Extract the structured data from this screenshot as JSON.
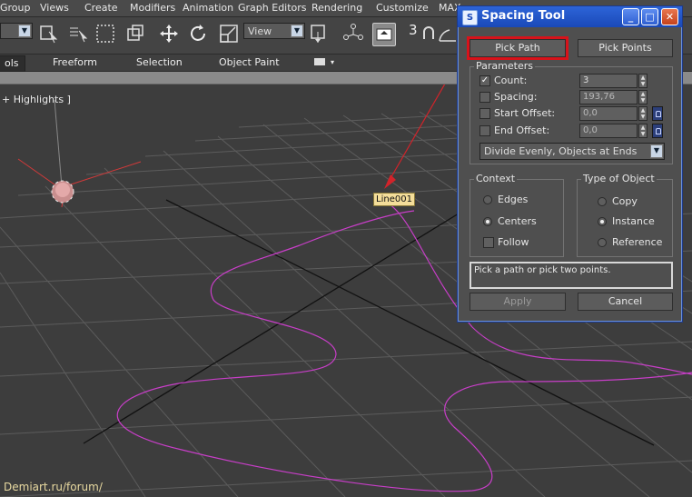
{
  "menubar": {
    "items": [
      "Group",
      "Views",
      "Create",
      "Modifiers",
      "Animation",
      "Graph Editors",
      "Rendering",
      "Customize",
      "MAX"
    ]
  },
  "toolbar": {
    "view_dropdown": "View",
    "snap_label": "3"
  },
  "ribbon": {
    "tabs": [
      "ols",
      "Freeform",
      "Selection",
      "Object Paint"
    ]
  },
  "viewport": {
    "label": "+ Highlights ]",
    "object_label": "Line001",
    "watermark": "Demiart.ru/forum/",
    "path_color": "#c83ec8",
    "light_axis_color": "#d23a3a"
  },
  "dialog": {
    "title": "Spacing Tool",
    "pick_path": "Pick Path",
    "pick_points": "Pick Points",
    "parameters": {
      "group_label": "Parameters",
      "count_label": "Count:",
      "count_checked": true,
      "count_value": "3",
      "spacing_label": "Spacing:",
      "spacing_value": "193,76",
      "start_offset_label": "Start Offset:",
      "start_offset_value": "0,0",
      "end_offset_label": "End Offset:",
      "end_offset_value": "0,0",
      "distribution": "Divide Evenly, Objects at Ends"
    },
    "context": {
      "group_label": "Context",
      "edges": "Edges",
      "centers": "Centers",
      "follow": "Follow",
      "selected": "centers"
    },
    "type_of_object": {
      "group_label": "Type of Object",
      "copy": "Copy",
      "instance": "Instance",
      "reference": "Reference",
      "selected": "instance"
    },
    "status_text": "Pick a path or pick two points.",
    "apply": "Apply",
    "cancel": "Cancel"
  }
}
